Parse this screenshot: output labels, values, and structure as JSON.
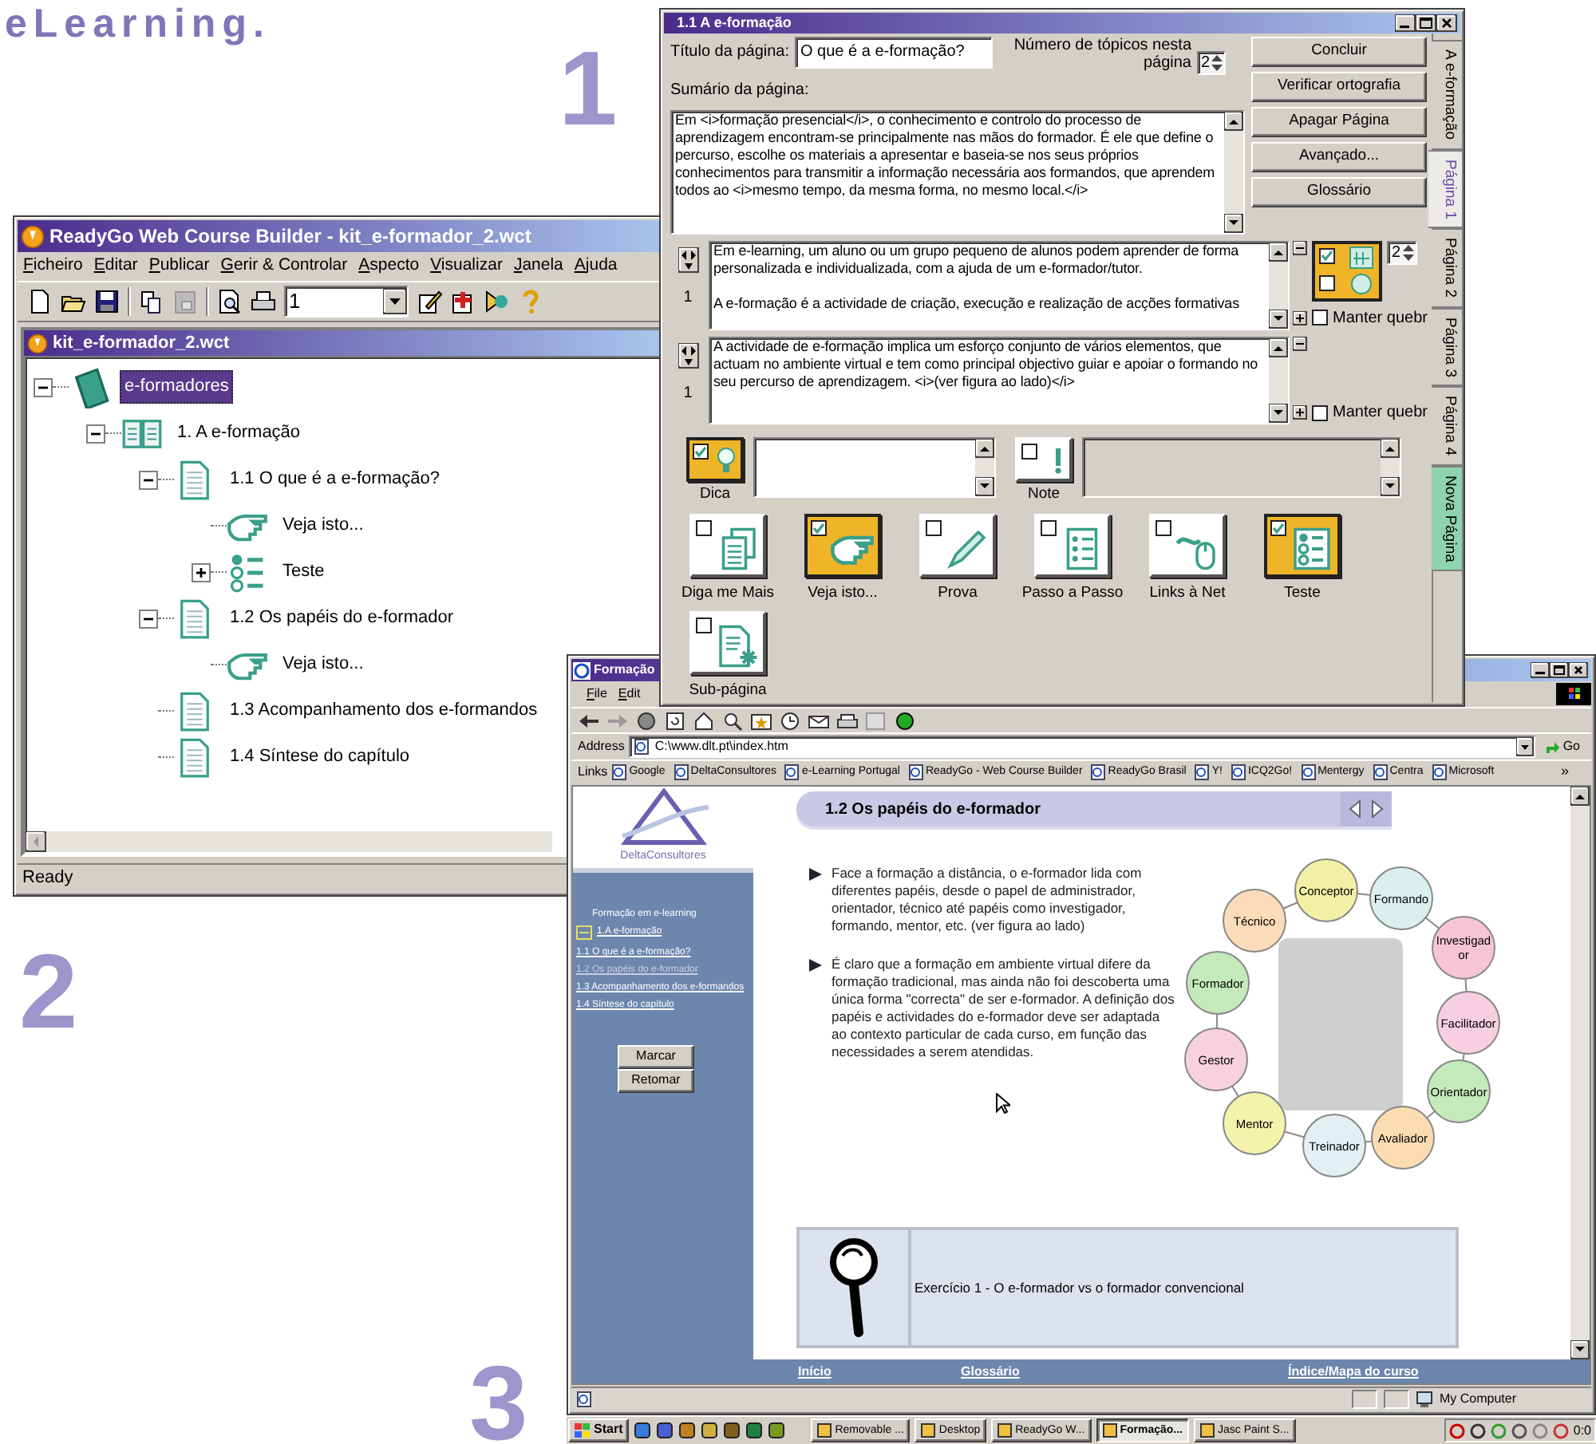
{
  "heading": "eLearning.",
  "figure_numbers": [
    "1",
    "2",
    "3"
  ],
  "builder_window": {
    "title": "ReadyGo Web Course Builder - kit_e-formador_2.wct",
    "menu": [
      "Ficheiro",
      "Editar",
      "Publicar",
      "Gerir & Controlar",
      "Aspecto",
      "Visualizar",
      "Janela",
      "Ajuda"
    ],
    "page_select": "1",
    "document": {
      "title": "kit_e-formador_2.wct",
      "tree": [
        {
          "label": "e-formadores",
          "kind": "book",
          "expanded": true,
          "selected": true,
          "children": [
            {
              "label": "1. A e-formação",
              "kind": "open-book",
              "expanded": true,
              "selected": false,
              "children": [
                {
                  "label": "1.1 O que é a e-formação?",
                  "kind": "page",
                  "expanded": true,
                  "selected": false,
                  "children": [
                    {
                      "label": "Veja isto...",
                      "kind": "hand",
                      "selected": false
                    },
                    {
                      "label": "Teste",
                      "kind": "quiz",
                      "expanded": false,
                      "selected": false
                    }
                  ]
                },
                {
                  "label": "1.2 Os papéis do e-formador",
                  "kind": "page",
                  "expanded": true,
                  "selected": false,
                  "children": [
                    {
                      "label": "Veja isto...",
                      "kind": "hand",
                      "selected": false
                    }
                  ]
                },
                {
                  "label": "1.3 Acompanhamento dos e-formandos",
                  "kind": "page",
                  "selected": false
                },
                {
                  "label": "1.4 Síntese do capítulo",
                  "kind": "page",
                  "selected": false
                }
              ]
            }
          ]
        }
      ]
    },
    "status": "Ready"
  },
  "editor_window": {
    "title": "1.1 A e-formação",
    "page_title_label": "Título da página:",
    "page_title": "O que é a e-formação?",
    "topic_count_label": "Número de tópicos nesta página",
    "topic_count": "2",
    "summary_label": "Sumário da página:",
    "summary": "Em <i>formação presencial</i>, o conhecimento e controlo do processo de aprendizagem encontram-se principalmente nas mãos do formador. É ele que define o percurso, escolhe os materiais a apresentar e baseia-se nos seus próprios conhecimentos para transmitir a informação necessária aos formandos, que aprendem todos ao <i>mesmo tempo, da mesma forma, no mesmo local.</i>",
    "buttons": [
      "Concluir",
      "Verificar ortografia",
      "Apagar Página",
      "Avançado...",
      "Glossário"
    ],
    "topics": [
      {
        "number": "1",
        "text": "Em e-learning, um aluno ou um grupo pequeno de alunos podem aprender de forma personalizada e individualizada, com a ajuda de um e-formador/tutor.\n\nA e-formação é a actividade de criação, execução e realização de acções formativas",
        "picture_count": "2",
        "keep_break_label": "Manter quebr",
        "keep_break": false
      },
      {
        "number": "1",
        "text": "A actividade de e-formação implica um esforço conjunto de vários elementos, que actuam no ambiente virtual e tem como principal objectivo guiar e apoiar o formando no seu percurso de aprendizagem. <i>(ver figura ao lado)</i>",
        "keep_break_label": "Manter quebr",
        "keep_break": false
      }
    ],
    "tip": {
      "label": "Dica",
      "checked": true
    },
    "note": {
      "label": "Note",
      "checked": false
    },
    "features": [
      {
        "kind": "more",
        "label": "Diga me Mais",
        "checked": false
      },
      {
        "kind": "see",
        "label": "Veja isto...",
        "checked": true
      },
      {
        "kind": "proof",
        "label": "Prova",
        "checked": false
      },
      {
        "kind": "steps",
        "label": "Passo a Passo",
        "checked": false
      },
      {
        "kind": "links",
        "label": "Links à Net",
        "checked": false
      },
      {
        "kind": "test",
        "label": "Teste",
        "checked": true
      },
      {
        "kind": "subpage",
        "label": "Sub-página",
        "checked": false
      }
    ],
    "tabs": [
      {
        "label": "A e-formação",
        "kind": "page",
        "selected": false
      },
      {
        "label": "Página 1",
        "kind": "page",
        "selected": true
      },
      {
        "label": "Página 2",
        "kind": "page",
        "selected": false
      },
      {
        "label": "Página 3",
        "kind": "page",
        "selected": false
      },
      {
        "label": "Página 4",
        "kind": "page",
        "selected": false
      },
      {
        "label": "Nova Página",
        "kind": "add",
        "selected": false
      }
    ]
  },
  "browser_window": {
    "title": "Formação",
    "menu": [
      "File",
      "Edit"
    ],
    "address_label": "Address",
    "address": "C:\\www.dlt.pt\\index.htm",
    "go_label": "Go",
    "links_label": "Links",
    "links": [
      "Google",
      "DeltaConsultores",
      "e-Learning Portugal",
      "ReadyGo - Web Course Builder",
      "ReadyGo Brasil",
      "Y!",
      "ICQ2Go!",
      "Mentergy",
      "Centra",
      "Microsoft"
    ],
    "more_links": "»",
    "page": {
      "logo_text": "DeltaConsultores",
      "course_title": "Formação em e-learning",
      "chapter": "1.A e-formação",
      "nav_items": [
        {
          "label": "1.1 O que é a e-formação?",
          "selected": false
        },
        {
          "label": "1.2 Os papéis do e-formador",
          "selected": true
        },
        {
          "label": "1.3 Acompanhamento dos e-formandos",
          "selected": false
        },
        {
          "label": "1.4 Síntese do capítulo",
          "selected": false
        }
      ],
      "buttons": [
        "Marcar",
        "Retomar"
      ],
      "heading": "1.2 Os papéis do e-formador",
      "paragraphs": [
        "Face a formação a distância, o e-formador lida com diferentes papéis, desde o papel de administrador, orientador, técnico até papéis como investigador, formando, mentor, etc. (ver figura ao lado)",
        "É claro que a formação em ambiente virtual difere da formação tradicional, mas ainda não foi descoberta uma única forma \"correcta\" de ser e-formador. A definição dos papéis e actividades do e-formador deve ser adaptada ao contexto particular de cada curso, em função das necessidades a serem atendidas."
      ],
      "roles": [
        {
          "label": "Técnico",
          "color": "#fbdcb8"
        },
        {
          "label": "Conceptor",
          "color": "#f2f0a4"
        },
        {
          "label": "Formando",
          "color": "#dcefef"
        },
        {
          "label": "Investigador",
          "color": "#f7c4d6"
        },
        {
          "label": "Facilitador",
          "color": "#f7cfe0"
        },
        {
          "label": "Orientador",
          "color": "#c4eabc"
        },
        {
          "label": "Avaliador",
          "color": "#fbdcb0"
        },
        {
          "label": "Treinador",
          "color": "#e2eff3"
        },
        {
          "label": "Mentor",
          "color": "#f3f3ac"
        },
        {
          "label": "Gestor",
          "color": "#f7d2de"
        },
        {
          "label": "Formador",
          "color": "#c4eabc"
        }
      ],
      "exercise": "Exercício 1 - O e-formador vs o formador convencional",
      "footer_links": [
        "Início",
        "Glossário",
        "Índice/Mapa do curso"
      ]
    },
    "status": "My Computer"
  },
  "taskbar": {
    "start": "Start",
    "tasks": [
      {
        "label": "Removable ...",
        "selected": false
      },
      {
        "label": "Desktop",
        "selected": false
      },
      {
        "label": "ReadyGo W...",
        "selected": false
      },
      {
        "label": "Formação...",
        "selected": true
      },
      {
        "label": "Jasc Paint S...",
        "selected": false
      }
    ],
    "clock": "0:0"
  }
}
